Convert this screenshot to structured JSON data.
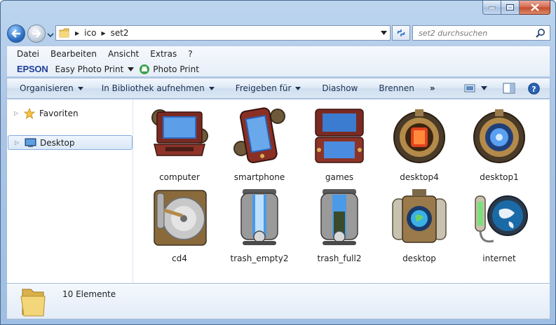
{
  "window": {
    "controls": {
      "minimize": "minimize-button",
      "maximize": "maximize-button",
      "close": "close-button"
    }
  },
  "address": {
    "crumbs": [
      "ico",
      "set2"
    ],
    "search_placeholder": "set2 durchsuchen"
  },
  "menubar": {
    "items": [
      "Datei",
      "Bearbeiten",
      "Ansicht",
      "Extras",
      "?"
    ]
  },
  "epson": {
    "logo": "EPSON",
    "easy_photo_print": "Easy Photo Print",
    "photo_print": "Photo Print"
  },
  "commandbar": {
    "organize": "Organisieren",
    "library": "In Bibliothek aufnehmen",
    "share": "Freigeben für",
    "slideshow": "Diashow",
    "burn": "Brennen",
    "more": "»"
  },
  "navpane": {
    "favorites": "Favoriten",
    "desktop": "Desktop"
  },
  "files": [
    {
      "name": "computer",
      "icon": "steampunk-laptop-icon"
    },
    {
      "name": "smartphone",
      "icon": "steampunk-smartphone-icon"
    },
    {
      "name": "games",
      "icon": "steampunk-handheld-console-icon"
    },
    {
      "name": "desktop4",
      "icon": "steampunk-reactor-red-icon"
    },
    {
      "name": "desktop1",
      "icon": "steampunk-reactor-blue-icon"
    },
    {
      "name": "cd4",
      "icon": "steampunk-cd-drive-icon"
    },
    {
      "name": "trash_empty2",
      "icon": "steampunk-trash-empty-icon"
    },
    {
      "name": "trash_full2",
      "icon": "steampunk-trash-full-icon"
    },
    {
      "name": "desktop",
      "icon": "steampunk-globe-capsule-icon"
    },
    {
      "name": "internet",
      "icon": "steampunk-globe-lamp-icon"
    }
  ],
  "status": {
    "count": "10 Elemente"
  },
  "colors": {
    "chrome": "#a9c5e6",
    "accent_blue": "#2c6fc4",
    "epson_blue": "#1f3d9a",
    "close_red": "#c44b2c"
  }
}
